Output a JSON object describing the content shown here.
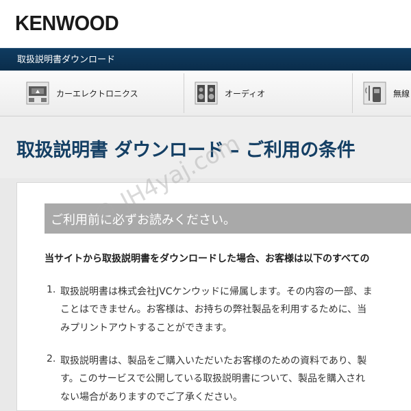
{
  "header": {
    "logo": "KENWOOD"
  },
  "blue_bar": {
    "label": "取扱説明書ダウンロード"
  },
  "nav": {
    "items": [
      {
        "label": "カーエレクトロニクス",
        "icon": "car-electronics-icon"
      },
      {
        "label": "オーディオ",
        "icon": "speaker-icon"
      },
      {
        "label": "無線",
        "icon": "radio-icon"
      }
    ]
  },
  "page": {
    "title": "取扱説明書 ダウンロード – ご利用の条件"
  },
  "content": {
    "notice": "ご利用前に必ずお読みください。",
    "intro": "当サイトから取扱説明書をダウンロードした場合、お客様は以下のすべての",
    "terms": [
      {
        "num": "1.",
        "lines": [
          "取扱説明書は株式会社JVCケンウッドに帰属します。その内容の一部、ま",
          "ことはできません。お客様は、お持ちの弊社製品を利用するために、当",
          "みプリントアウトすることができます。"
        ]
      },
      {
        "num": "2.",
        "lines": [
          "取扱説明書は、製品をご購入いただいたお客様のための資料であり、製",
          "す。このサービスで公開している取扱説明書について、製品を購入され",
          "ない場合がありますのでご了承ください。"
        ]
      }
    ]
  },
  "watermark": "© JH4yaj.com"
}
